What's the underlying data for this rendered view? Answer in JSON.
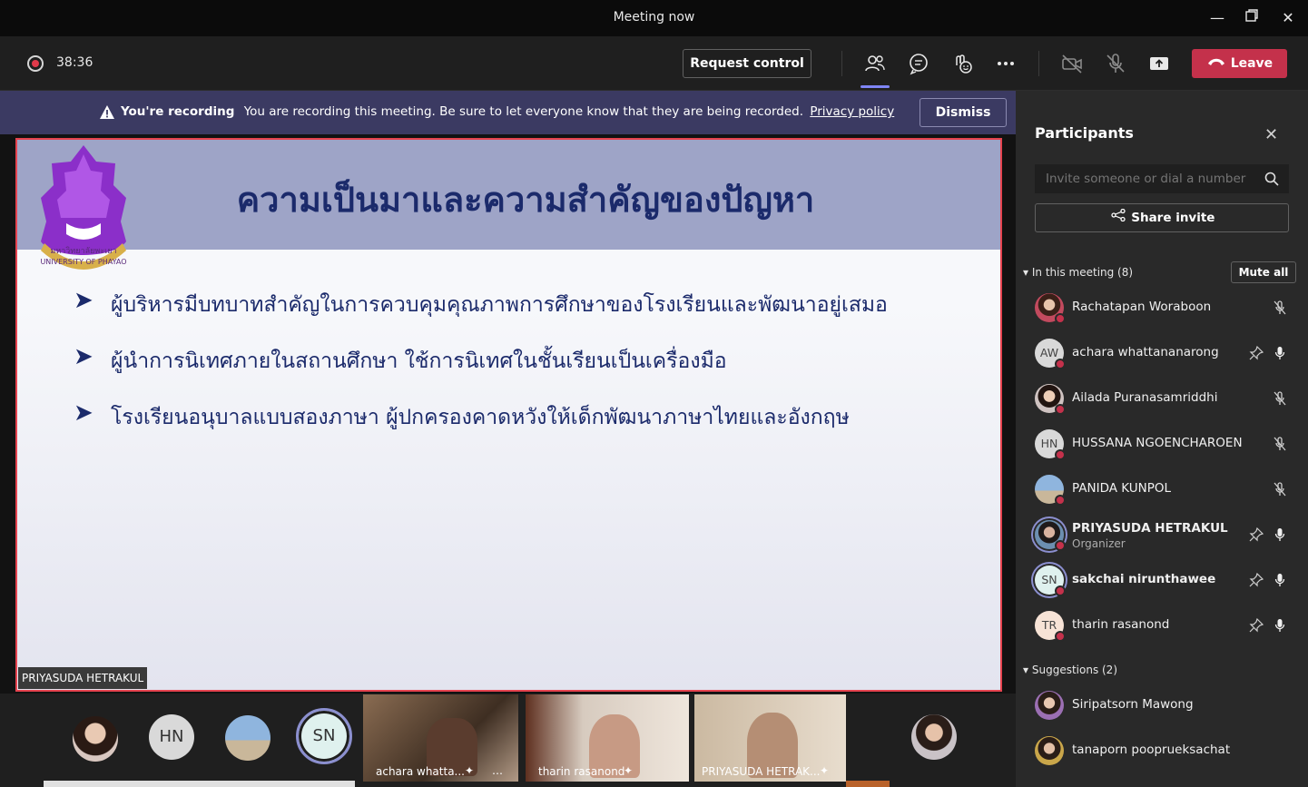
{
  "window": {
    "title": "Meeting now"
  },
  "toolbar": {
    "timer": "38:36",
    "request_control": "Request control",
    "leave": "Leave"
  },
  "banner": {
    "bold": "You're recording",
    "message": "You are recording this meeting. Be sure to let everyone know that they are being recorded.",
    "link": "Privacy policy",
    "dismiss": "Dismiss"
  },
  "slide": {
    "title": "ความเป็นมาและความสำคัญของปัญหา",
    "logo_text": "มหาวิทยาลัยพะเยา",
    "logo_text_en": "UNIVERSITY OF PHAYAO",
    "bullets": [
      "ผู้บริหารมีบทบาทสำคัญในการควบคุมคุณภาพการศึกษาของโรงเรียนและพัฒนาอยู่เสมอ",
      "ผู้นำการนิเทศภายในสถานศึกษา ใช้การนิเทศในชั้นเรียนเป็นเครื่องมือ",
      "โรงเรียนอนุบาลแบบสองภาษา ผู้ปกครองคาดหวังให้เด็กพัฒนาภาษาไทยและอังกฤษ"
    ],
    "presenter": "PRIYASUDA HETRAKUL"
  },
  "strip": {
    "avatars": [
      "HN",
      "SN"
    ],
    "tiles": [
      {
        "name": "achara whatta..."
      },
      {
        "name": "tharin rasanond"
      },
      {
        "name": "PRIYASUDA HETRAK..."
      }
    ]
  },
  "participants": {
    "title": "Participants",
    "invite_placeholder": "Invite someone or dial a number",
    "share_invite": "Share invite",
    "in_meeting_label": "In this meeting (8)",
    "mute_all": "Mute all",
    "members": [
      {
        "name": "Rachatapan Woraboon",
        "initials": "",
        "role": "",
        "status": "muted"
      },
      {
        "name": "achara whattananarong",
        "initials": "AW",
        "role": "",
        "status": "unmuted"
      },
      {
        "name": "Ailada Puranasamriddhi",
        "initials": "",
        "role": "",
        "status": "muted"
      },
      {
        "name": "HUSSANA NGOENCHAROEN",
        "initials": "HN",
        "role": "",
        "status": "muted"
      },
      {
        "name": "PANIDA KUNPOL",
        "initials": "",
        "role": "",
        "status": "muted"
      },
      {
        "name": "PRIYASUDA HETRAKUL",
        "initials": "",
        "role": "Organizer",
        "status": "unmuted"
      },
      {
        "name": "sakchai nirunthawee",
        "initials": "SN",
        "role": "",
        "status": "unmuted"
      },
      {
        "name": "tharin rasanond",
        "initials": "TR",
        "role": "",
        "status": "unmuted"
      }
    ],
    "suggestions_label": "Suggestions (2)",
    "suggestions": [
      {
        "name": "Siripatsorn Mawong"
      },
      {
        "name": "tanaporn pooprueksachat"
      }
    ]
  },
  "colors": {
    "accent": "#7f85f5",
    "leave": "#c4314b",
    "banner": "#3b3a62",
    "slide_title": "#1b2a6b"
  }
}
